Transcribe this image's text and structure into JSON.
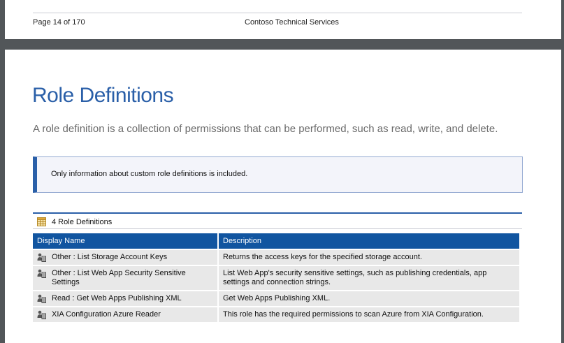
{
  "footer": {
    "page_label": "Page 14 of 170",
    "company": "Contoso Technical Services"
  },
  "heading": {
    "title": "Role Definitions",
    "subtitle": "A role definition is a collection of permissions that can be performed, such as read, write, and delete."
  },
  "note": {
    "text": "Only information about custom role definitions is included."
  },
  "table": {
    "caption": "4 Role Definitions",
    "columns": [
      "Display Name",
      "Description"
    ],
    "rows": [
      {
        "name": "Other : List Storage Account Keys",
        "description": "Returns the access keys for the specified storage account."
      },
      {
        "name": "Other : List Web App Security Sensitive Settings",
        "description": "List Web App's security sensitive settings, such as publishing credentials, app settings and connection strings."
      },
      {
        "name": "Read : Get Web Apps Publishing XML",
        "description": "Get Web Apps Publishing XML."
      },
      {
        "name": "XIA Configuration Azure Reader",
        "description": "This role has the required permissions to scan Azure from XIA Configuration."
      }
    ]
  },
  "colors": {
    "accent": "#2a5fa8",
    "header_bg": "#1155a0",
    "row_bg": "#e8e8e8",
    "note_bg": "#f3f4fa"
  },
  "icons": {
    "caption": "table-icon",
    "row": "role-definition-icon"
  }
}
